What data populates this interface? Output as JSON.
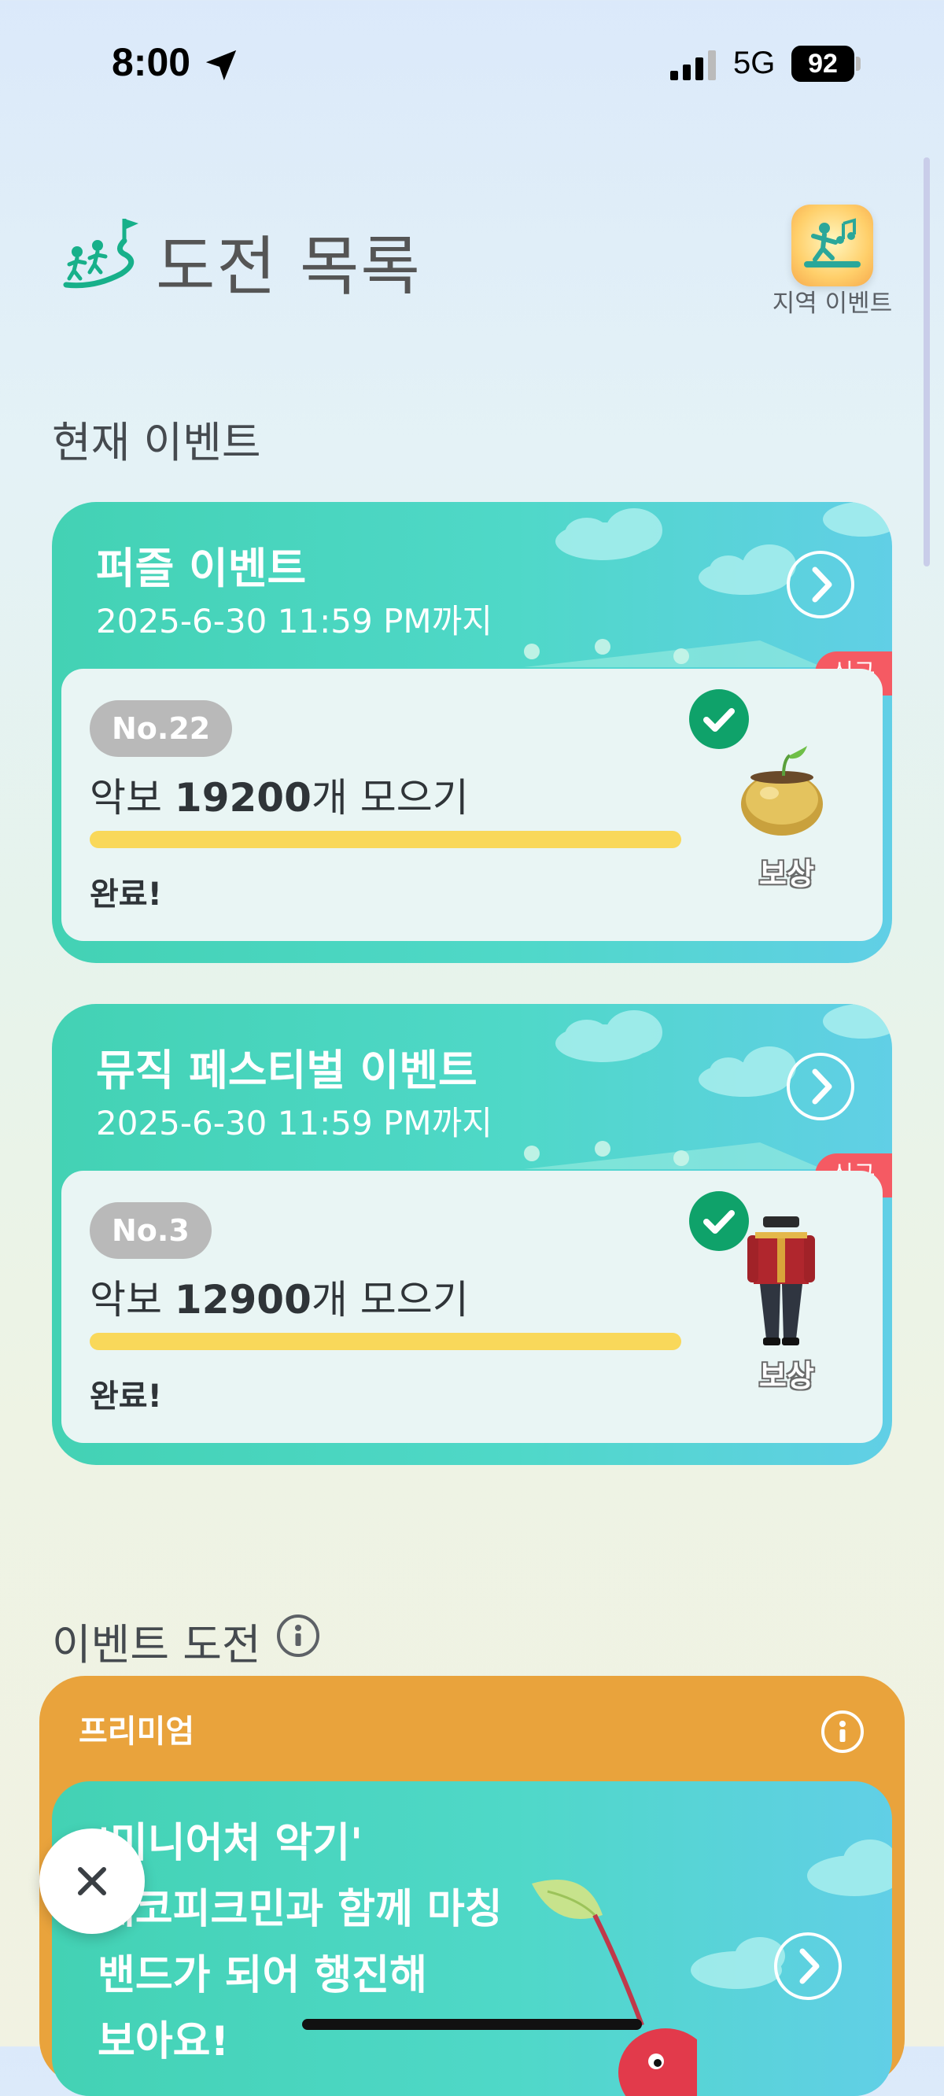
{
  "status_bar": {
    "time": "8:00",
    "network": "5G",
    "battery": "92"
  },
  "header": {
    "title": "도전 목록",
    "title_icon": "hiking-people-flag-icon",
    "local_event_label": "지역 이벤트",
    "local_event_icon": "dancing-person-music-icon"
  },
  "current_events": {
    "section_title": "현재 이벤트",
    "cards": [
      {
        "title": "퍼즐 이벤트",
        "deadline": "2025-6-30 11:59 PM까지",
        "new_badge": "신규",
        "number": "No.22",
        "goal_prefix": "악보 ",
        "goal_count": "19200",
        "goal_suffix": "개 모으기",
        "progress": 1.0,
        "status": "완료!",
        "reward_label": "보상",
        "reward_icon": "golden-pot-sprout-icon"
      },
      {
        "title": "뮤직 페스티벌 이벤트",
        "deadline": "2025-6-30 11:59 PM까지",
        "new_badge": "신규",
        "number": "No.3",
        "goal_prefix": "악보 ",
        "goal_count": "12900",
        "goal_suffix": "개 모으기",
        "progress": 1.0,
        "status": "완료!",
        "reward_label": "보상",
        "reward_icon": "marching-band-outfit-icon"
      }
    ]
  },
  "event_challenge": {
    "section_title": "이벤트 도전",
    "premium": {
      "label": "프리미엄",
      "lines": [
        "'미니어처 악기'",
        "데코피크민과 함께 마칭",
        "밴드가 되어 행진해",
        "보아요!"
      ]
    }
  },
  "colors": {
    "teal_card": "#4fd8c8",
    "new_badge": "#f55a63",
    "check": "#0fa26a",
    "progress": "#f9d85a",
    "premium": "#e9a33c"
  }
}
